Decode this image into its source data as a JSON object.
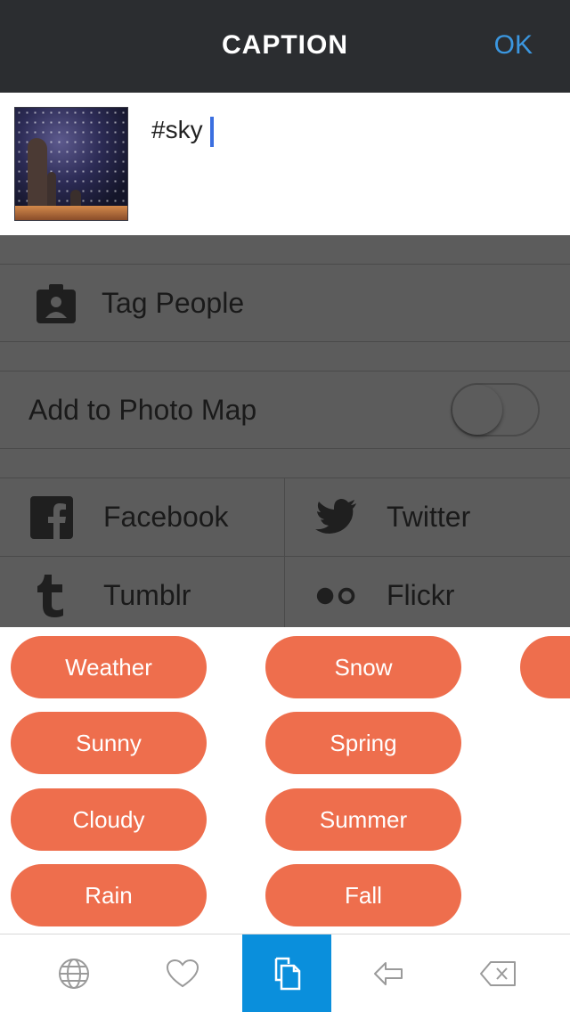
{
  "header": {
    "title": "CAPTION",
    "ok_label": "OK"
  },
  "caption": {
    "text": "#sky"
  },
  "settings": {
    "tag_people": "Tag People",
    "photo_map": {
      "label": "Add to Photo Map",
      "enabled": false
    },
    "share": {
      "facebook": "Facebook",
      "twitter": "Twitter",
      "tumblr": "Tumblr",
      "flickr": "Flickr"
    }
  },
  "suggestions": {
    "col1": [
      "Weather",
      "Sunny",
      "Cloudy",
      "Rain"
    ],
    "col2": [
      "Snow",
      "Spring",
      "Summer",
      "Fall"
    ]
  },
  "toolbar": {
    "items": [
      "globe-icon",
      "heart-icon",
      "pages-icon",
      "back-arrow-icon",
      "delete-icon"
    ],
    "active_index": 2
  },
  "colors": {
    "accent": "#3b97e0",
    "pill": "#ee6e4d",
    "active_tool": "#0a8fdc",
    "header_bg": "#2b2d30"
  }
}
